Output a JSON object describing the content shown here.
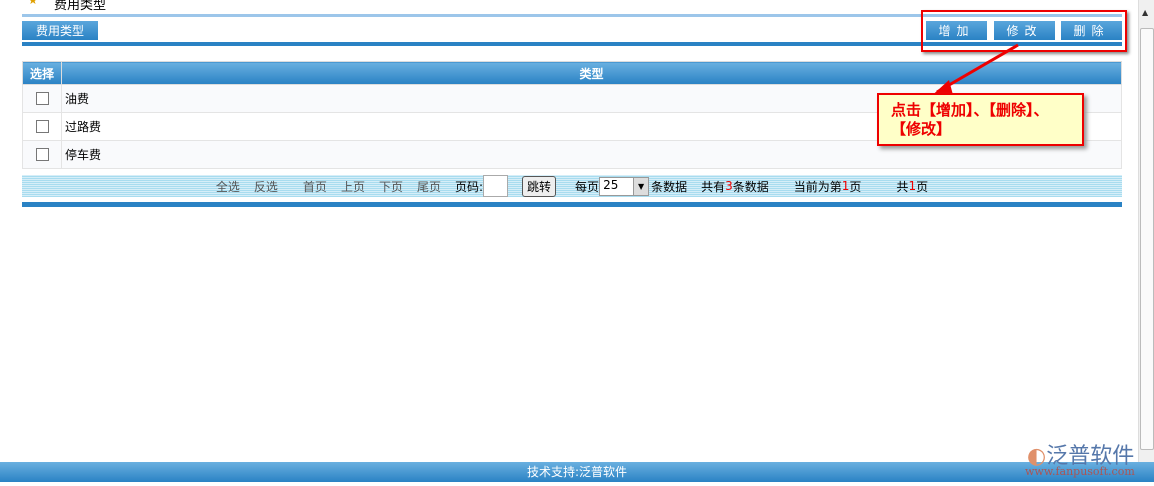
{
  "page_title": "费用类型",
  "tab_label": "费用类型",
  "toolbar": {
    "add": "增加",
    "edit": "修改",
    "delete": "删除"
  },
  "table": {
    "headers": [
      "选择",
      "类型"
    ],
    "rows": [
      {
        "type": "油费"
      },
      {
        "type": "过路费"
      },
      {
        "type": "停车费"
      }
    ]
  },
  "pager": {
    "select_all": "全选",
    "invert": "反选",
    "first": "首页",
    "prev": "上页",
    "next": "下页",
    "last": "尾页",
    "page_label": "页码:",
    "page_input": "",
    "jump": "跳转",
    "per_page_label": "每页",
    "per_page": "25",
    "per_page_suffix": "条数据",
    "total_prefix": "共有",
    "total": "3",
    "total_suffix": "条数据",
    "current_prefix": "当前为第",
    "current": "1",
    "current_suffix": "页",
    "pages_prefix": "共",
    "pages": "1",
    "pages_suffix": "页"
  },
  "callout": "点击【增加】、【删除】、【修改】",
  "footer": "技术支持:泛普软件",
  "logo": {
    "name": "泛普软件",
    "url": "www.fanpusoft.com"
  }
}
